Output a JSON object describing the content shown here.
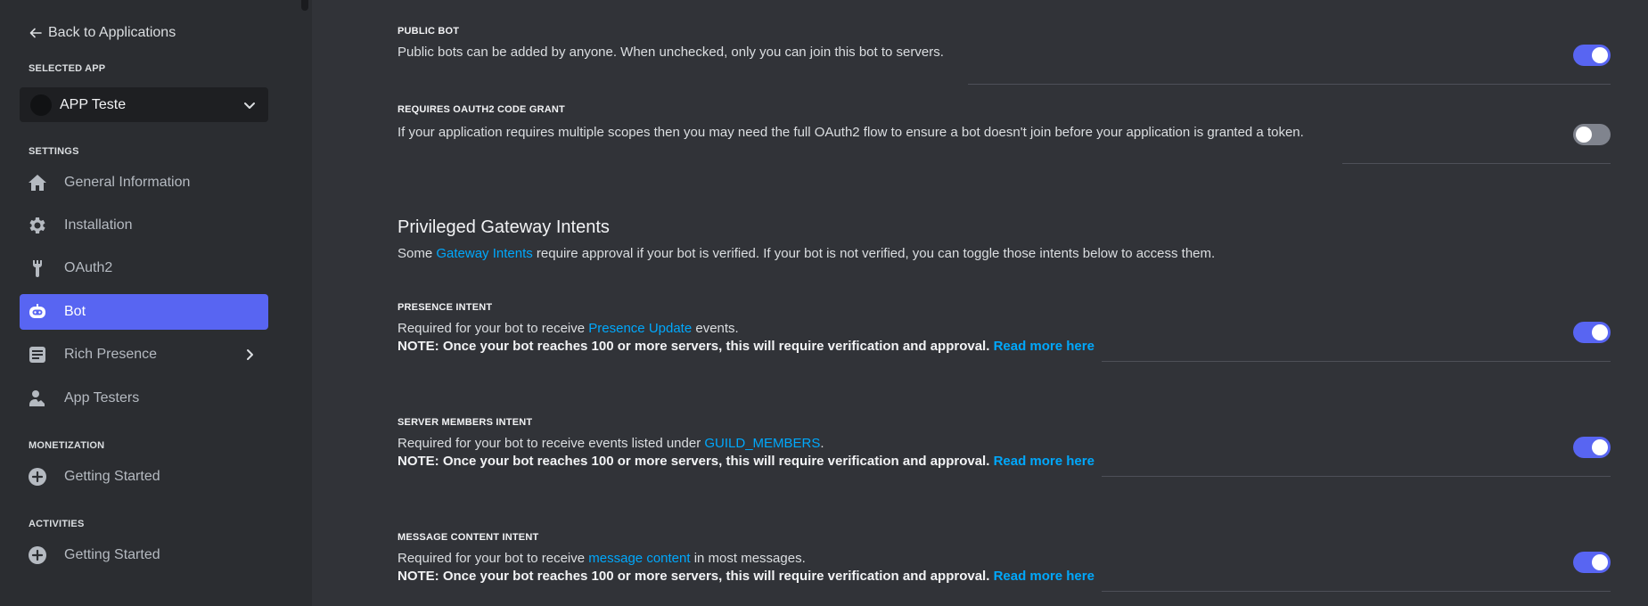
{
  "sidebar": {
    "back_label": "Back to Applications",
    "selected_app_heading": "SELECTED APP",
    "app_name": "APP Teste",
    "settings_heading": "SETTINGS",
    "items": [
      {
        "label": "General Information",
        "icon": "home-icon"
      },
      {
        "label": "Installation",
        "icon": "gear-icon"
      },
      {
        "label": "OAuth2",
        "icon": "wrench-icon"
      },
      {
        "label": "Bot",
        "icon": "bot-icon",
        "active": true
      },
      {
        "label": "Rich Presence",
        "icon": "document-icon",
        "has_submenu": true
      },
      {
        "label": "App Testers",
        "icon": "person-icon"
      }
    ],
    "monetization_heading": "MONETIZATION",
    "monetization_item": "Getting Started",
    "activities_heading": "ACTIVITIES",
    "activities_item": "Getting Started"
  },
  "main": {
    "public_bot": {
      "title": "PUBLIC BOT",
      "desc": "Public bots can be added by anyone. When unchecked, only you can join this bot to servers.",
      "enabled": true
    },
    "oauth2_grant": {
      "title": "REQUIRES OAUTH2 CODE GRANT",
      "desc": "If your application requires multiple scopes then you may need the full OAuth2 flow to ensure a bot doesn't join before your application is granted a token.",
      "enabled": false
    },
    "privileged": {
      "heading": "Privileged Gateway Intents",
      "sub_pre": "Some ",
      "sub_link": "Gateway Intents",
      "sub_post": " require approval if your bot is verified. If your bot is not verified, you can toggle those intents below to access them."
    },
    "note_text": "NOTE: Once your bot reaches 100 or more servers, this will require verification and approval.",
    "read_more": "Read more here",
    "presence": {
      "title": "PRESENCE INTENT",
      "pre": "Required for your bot to receive ",
      "link": "Presence Update",
      "post": " events.",
      "enabled": true
    },
    "members": {
      "title": "SERVER MEMBERS INTENT",
      "pre": "Required for your bot to receive events listed under ",
      "link": "GUILD_MEMBERS",
      "post": ".",
      "enabled": true
    },
    "message": {
      "title": "MESSAGE CONTENT INTENT",
      "pre": "Required for your bot to receive ",
      "link": "message content",
      "post": " in most messages.",
      "enabled": true
    }
  },
  "colors": {
    "accent": "#5865f2",
    "link": "#00a8fc",
    "background": "#313338",
    "sidebar": "#2b2d31"
  }
}
